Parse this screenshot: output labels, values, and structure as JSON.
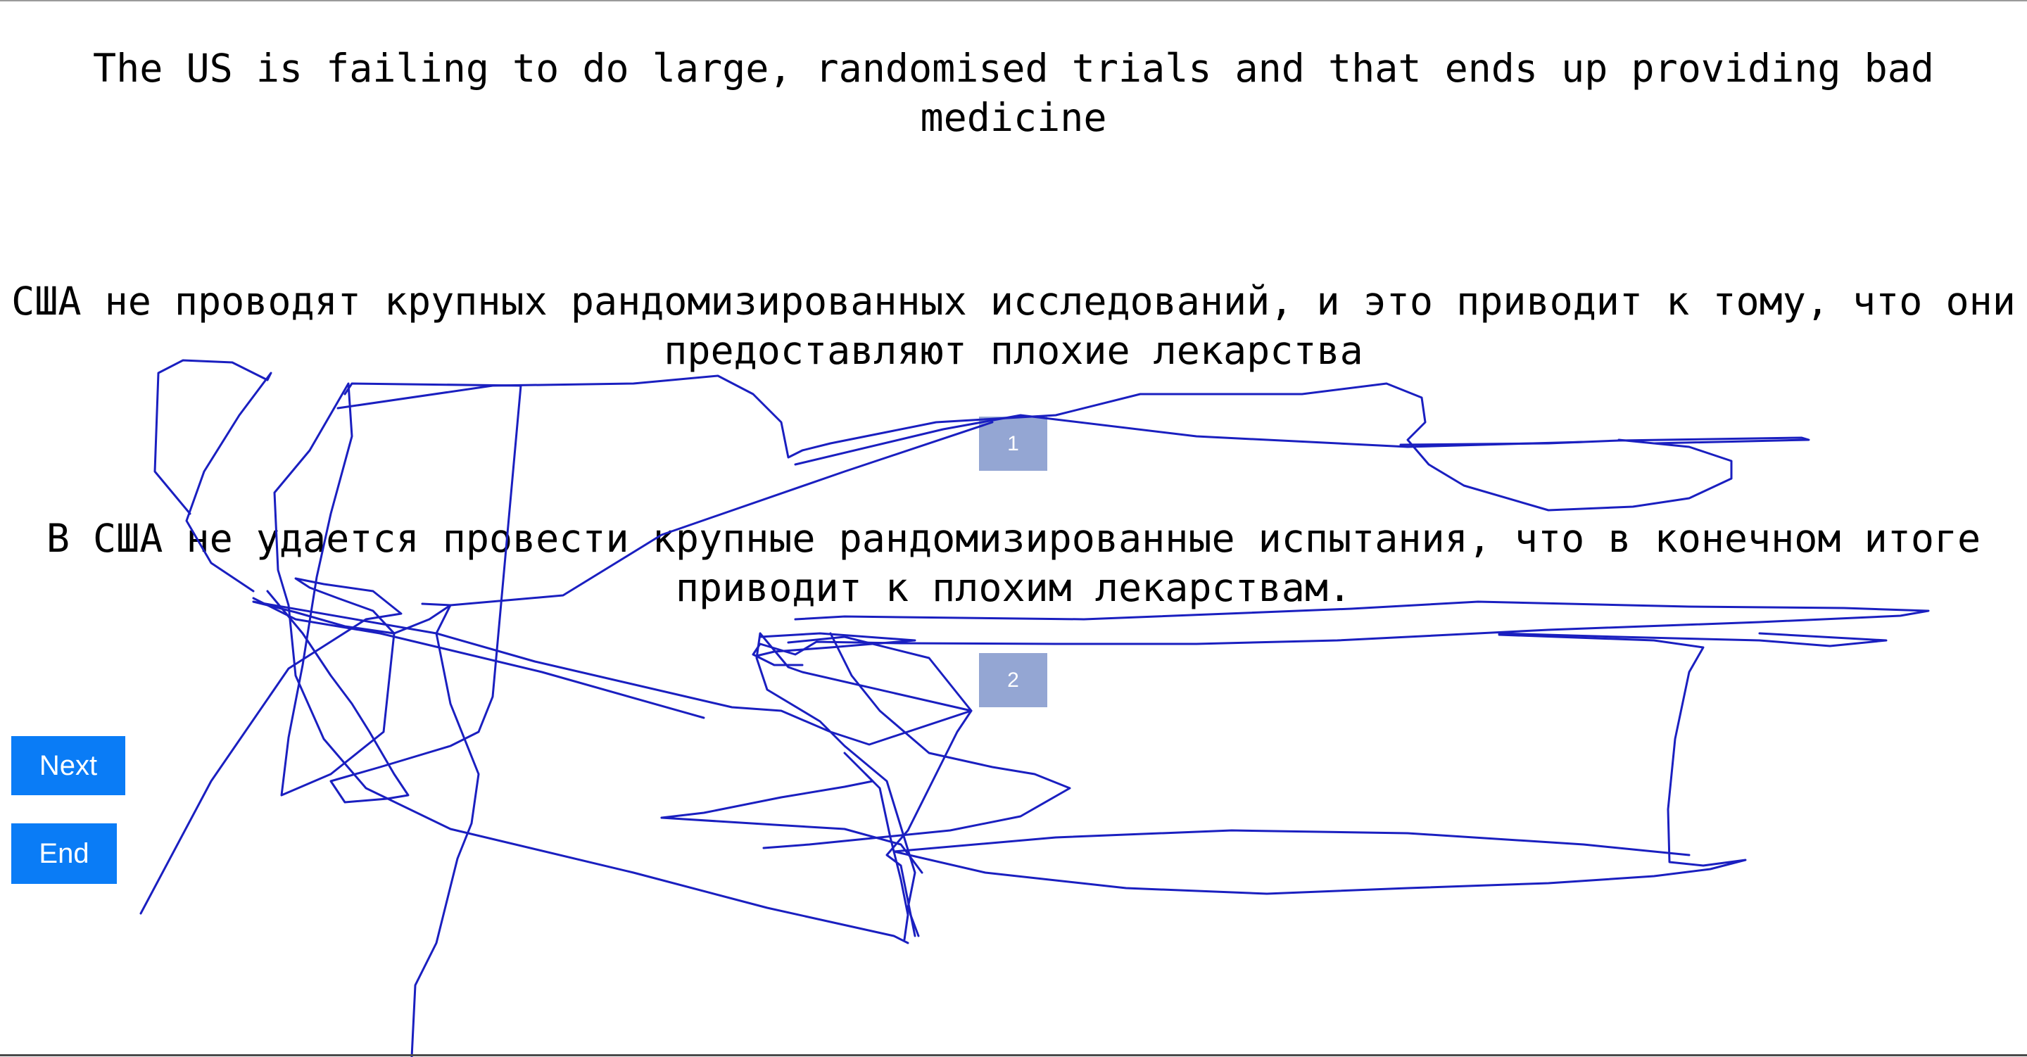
{
  "sentences": {
    "source": "The US is failing to do large, randomised trials and that ends up providing bad medicine",
    "translation_1": "США не проводят крупных рандомизированных исследований, и это приводит к тому, что они предоставляют плохие лекарства",
    "translation_2": "В США не удается провести крупные рандомизированные испытания, что в конечном итоге приводит к плохим лекарствам."
  },
  "badges": {
    "first": "1",
    "second": "2"
  },
  "buttons": {
    "next_label": "Next",
    "end_label": "End"
  },
  "colors": {
    "badge": "#94a6d3",
    "button": "#0a7cf6",
    "scribble": "#1a1fc0"
  }
}
